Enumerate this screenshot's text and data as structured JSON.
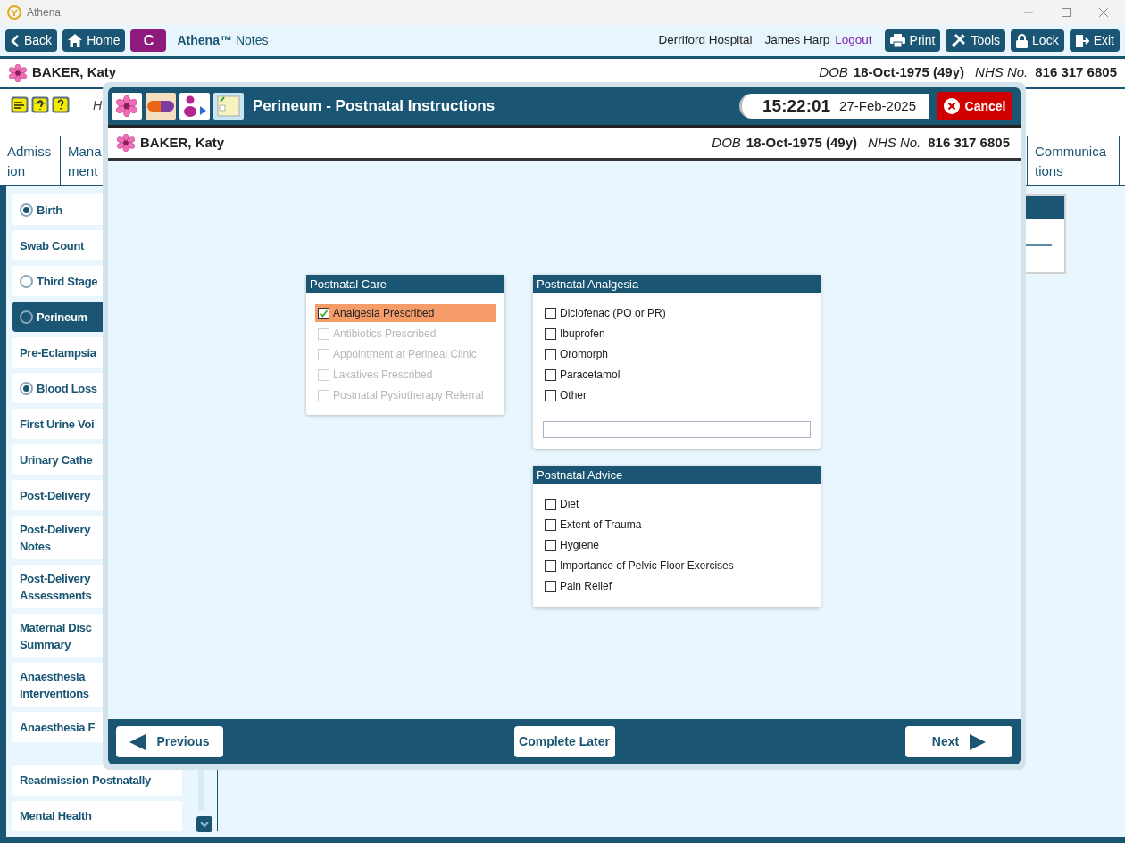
{
  "window": {
    "title": "Athena"
  },
  "toolbar": {
    "buttons": [
      {
        "kind": "back",
        "label": "Back"
      },
      {
        "kind": "home",
        "label": "Home"
      },
      {
        "kind": "letter",
        "label": "C"
      }
    ],
    "app_brand": "Athena™",
    "app_name": "Notes",
    "hospital": "Derriford Hospital",
    "user": "James Harp",
    "logout": "Logout",
    "right_buttons": [
      {
        "kind": "print",
        "label": "Print"
      },
      {
        "kind": "tools",
        "label": "Tools"
      },
      {
        "kind": "lock",
        "label": "Lock"
      },
      {
        "kind": "exit",
        "label": "Exit"
      }
    ]
  },
  "patient": {
    "name": "BAKER, Katy",
    "dob_label": "DOB",
    "dob": "18-Oct-1975 (49y)",
    "nhs_label": "NHS No.",
    "nhs": "816 317 6805"
  },
  "info_row": {
    "text": "H"
  },
  "tabs": [
    {
      "lines": [
        "Admiss",
        "ion"
      ]
    },
    {
      "lines": [
        "Mana",
        "ment"
      ]
    },
    {
      "lines": [
        "Communica",
        "tions"
      ]
    }
  ],
  "sidebar": {
    "items": [
      {
        "label": "Birth",
        "kind": "done",
        "selected": false
      },
      {
        "label": "Swab Count",
        "kind": "plain",
        "selected": false
      },
      {
        "label": "Third Stage",
        "kind": "pending",
        "selected": false
      },
      {
        "label": "Perineum",
        "kind": "pending",
        "selected": true
      },
      {
        "label": "Pre-Eclampsia",
        "kind": "plain",
        "selected": false
      },
      {
        "label": "Blood Loss",
        "kind": "done",
        "selected": false
      },
      {
        "label": "First Urine Voi",
        "kind": "plain",
        "selected": false
      },
      {
        "label": "Urinary Cathe",
        "kind": "plain",
        "selected": false
      },
      {
        "label": "Post-Delivery",
        "kind": "plain",
        "selected": false
      },
      {
        "label": "Post-Delivery\nNotes",
        "kind": "plain",
        "selected": false
      },
      {
        "label": "Post-Delivery\nAssessments",
        "kind": "plain",
        "selected": false
      },
      {
        "label": "Maternal Disc\nSummary",
        "kind": "plain",
        "selected": false
      },
      {
        "label": "Anaesthesia\nInterventions",
        "kind": "plain",
        "selected": false
      },
      {
        "label": "Anaesthesia F",
        "kind": "plain",
        "selected": false
      }
    ],
    "lower_items": [
      {
        "label": "Readmission Postnatally",
        "selected": false
      },
      {
        "label": "Mental Health",
        "selected": false
      }
    ]
  },
  "dialog": {
    "icons": [
      {
        "kind": "flower"
      },
      {
        "kind": "pill"
      },
      {
        "kind": "person-arrow"
      },
      {
        "kind": "note"
      }
    ],
    "title": "Perineum - Postnatal Instructions",
    "time": "15:22:01",
    "date": "27-Feb-2025",
    "cancel": "Cancel",
    "patient": {
      "name": "BAKER, Katy",
      "dob_label": "DOB",
      "dob": "18-Oct-1975 (49y)",
      "nhs_label": "NHS No.",
      "nhs": "816 317 6805"
    },
    "postnatal_care": {
      "title": "Postnatal Care",
      "options": [
        {
          "label": "Analgesia Prescribed",
          "checked": true,
          "disabled": false,
          "selected": true
        },
        {
          "label": "Antibiotics Prescribed",
          "checked": false,
          "disabled": true,
          "selected": false
        },
        {
          "label": "Appointment at Perineal Clinic",
          "checked": false,
          "disabled": true,
          "selected": false
        },
        {
          "label": "Laxatives Prescribed",
          "checked": false,
          "disabled": true,
          "selected": false
        },
        {
          "label": "Postnatal Pysiotherapy Referral",
          "checked": false,
          "disabled": true,
          "selected": false
        }
      ]
    },
    "postnatal_analgesia": {
      "title": "Postnatal Analgesia",
      "options": [
        {
          "label": "Diclofenac (PO or PR)",
          "checked": false
        },
        {
          "label": "Ibuprofen",
          "checked": false
        },
        {
          "label": "Oromorph",
          "checked": false
        },
        {
          "label": "Paracetamol",
          "checked": false
        },
        {
          "label": "Other",
          "checked": false
        }
      ]
    },
    "postnatal_advice": {
      "title": "Postnatal Advice",
      "options": [
        {
          "label": "Diet",
          "checked": false
        },
        {
          "label": "Extent of Trauma",
          "checked": false
        },
        {
          "label": "Hygiene",
          "checked": false
        },
        {
          "label": "Importance of Pelvic Floor Exercises",
          "checked": false
        },
        {
          "label": "Pain Relief",
          "checked": false
        }
      ]
    },
    "footer": {
      "previous": "Previous",
      "complete_later": "Complete Later",
      "next": "Next"
    }
  }
}
